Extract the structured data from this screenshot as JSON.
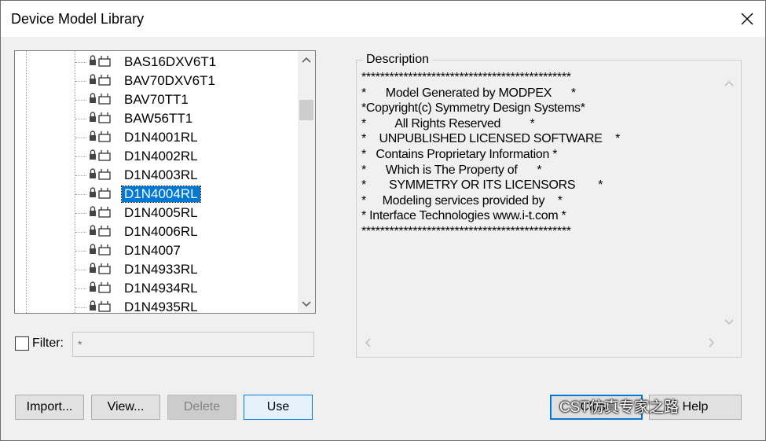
{
  "window": {
    "title": "Device Model Library"
  },
  "tree": {
    "items": [
      {
        "label": "BAS16DXV6T1",
        "selected": false
      },
      {
        "label": "BAV70DXV6T1",
        "selected": false
      },
      {
        "label": "BAV70TT1",
        "selected": false
      },
      {
        "label": "BAW56TT1",
        "selected": false
      },
      {
        "label": "D1N4001RL",
        "selected": false
      },
      {
        "label": "D1N4002RL",
        "selected": false
      },
      {
        "label": "D1N4003RL",
        "selected": false
      },
      {
        "label": "D1N4004RL",
        "selected": true
      },
      {
        "label": "D1N4005RL",
        "selected": false
      },
      {
        "label": "D1N4006RL",
        "selected": false
      },
      {
        "label": "D1N4007",
        "selected": false
      },
      {
        "label": "D1N4933RL",
        "selected": false
      },
      {
        "label": "D1N4934RL",
        "selected": false
      },
      {
        "label": "D1N4935RL",
        "selected": false
      }
    ]
  },
  "filter": {
    "label": "Filter:",
    "value": "*",
    "checked": false
  },
  "description": {
    "label": "Description",
    "lines": [
      "*********************************************",
      "*      Model Generated by MODPEX      *",
      "*Copyright(c) Symmetry Design Systems*",
      "*         All Rights Reserved         *",
      "*    UNPUBLISHED LICENSED SOFTWARE    *",
      "*   Contains Proprietary Information *",
      "*      Which is The Property of      *",
      "*       SYMMETRY OR ITS LICENSORS       *",
      "*     Modeling services provided by    *",
      "* Interface Technologies www.i-t.com *",
      "*********************************************"
    ]
  },
  "buttons": {
    "import": "Import...",
    "view": "View...",
    "delete": "Delete",
    "use": "Use",
    "close": "Close",
    "help": "Help"
  },
  "watermark": "CST仿真专家之路",
  "colors": {
    "selection": "#0078d7",
    "accent": "#0078d7"
  }
}
